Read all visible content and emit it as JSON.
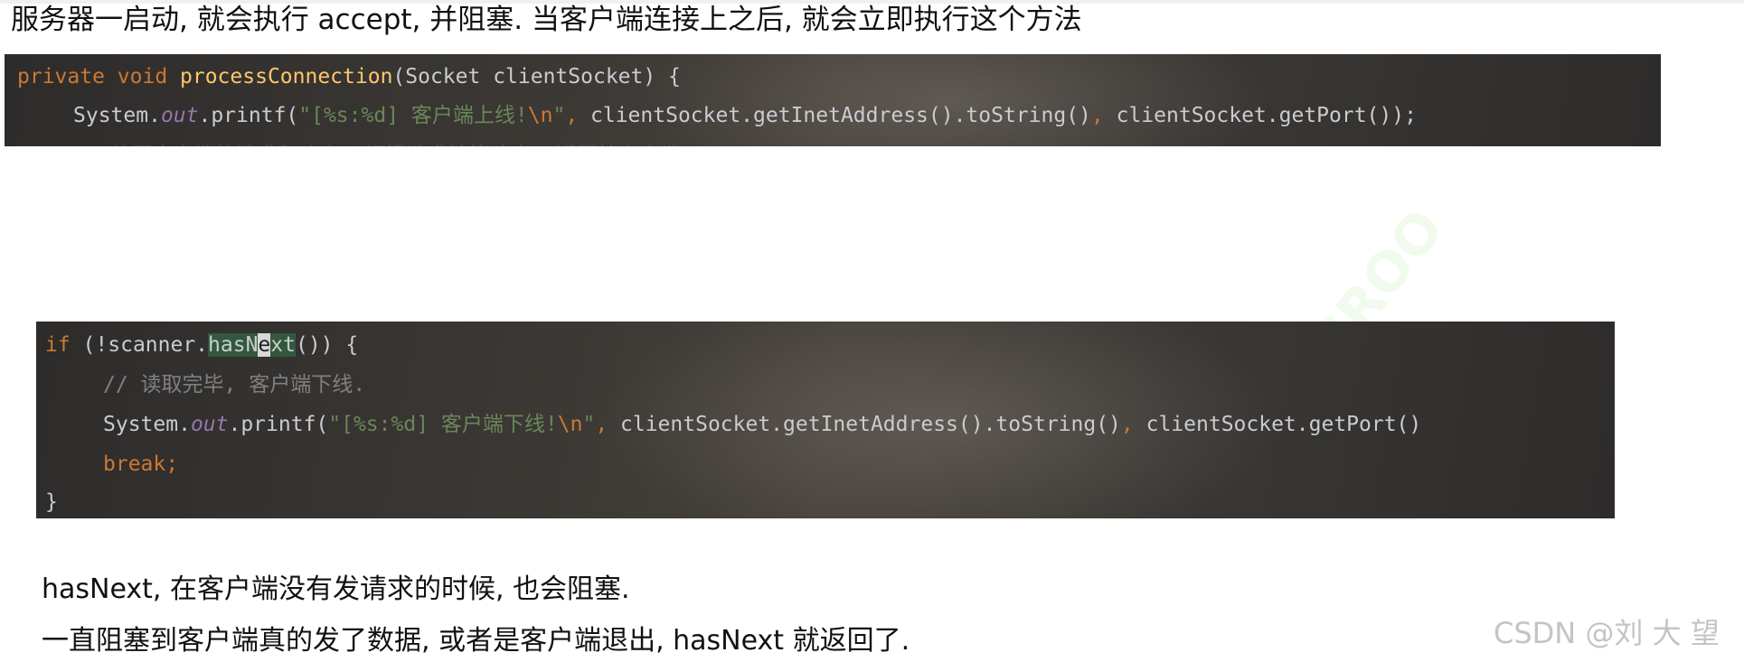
{
  "heading": "服务器一启动, 就会执行 accept, 并阻塞. 当客户端连接上之后, 就会立即执行这个方法",
  "code_block_1": {
    "line1": {
      "kw": "private void ",
      "method": "processConnection",
      "rest": "(Socket clientSocket) {"
    },
    "line2": {
      "system": "System.",
      "out": "out",
      "printf": ".printf(",
      "str_open": "\"[%s:%d] 客户端上线!",
      "esc": "\\n",
      "str_close": "\"",
      "comma": ", ",
      "arg1": "clientSocket.getInetAddress().toString()",
      "comma2": ", ",
      "arg2": "clientSocket.getPort());"
    },
    "line3_faded": "// 处理客户端的请求和响应, 根据请求计算响应, 返回给客户端"
  },
  "code_block_2": {
    "line1": {
      "kw": "if",
      "pre": " (!scanner.",
      "hl1": "hasN",
      "caret": "e",
      "hl2": "xt",
      "post": "()) {"
    },
    "line2": "// 读取完毕, 客户端下线.",
    "line3": {
      "system": "System.",
      "out": "out",
      "printf": ".printf(",
      "str_open": "\"[%s:%d] 客户端下线!",
      "esc": "\\n",
      "str_close": "\"",
      "comma": ", ",
      "arg1": "clientSocket.getInetAddress().toString()",
      "comma2": ", ",
      "arg2": "clientSocket.getPort()"
    },
    "line4": "break;",
    "line5": "}"
  },
  "paragraph_1": "hasNext, 在客户端没有发请求的时候, 也会阻塞.",
  "paragraph_2": "一直阻塞到客户端真的发了数据, 或者是客户端退出, hasNext 就返回了.",
  "watermark": "CSDN @刘 大 望",
  "colors": {
    "keyword": "#cc7832",
    "method": "#ffc66d",
    "string": "#6a8759",
    "static_field": "#9876aa",
    "comment": "#808080",
    "code_text": "#c9ccd1",
    "code_background": "#3a3734"
  }
}
